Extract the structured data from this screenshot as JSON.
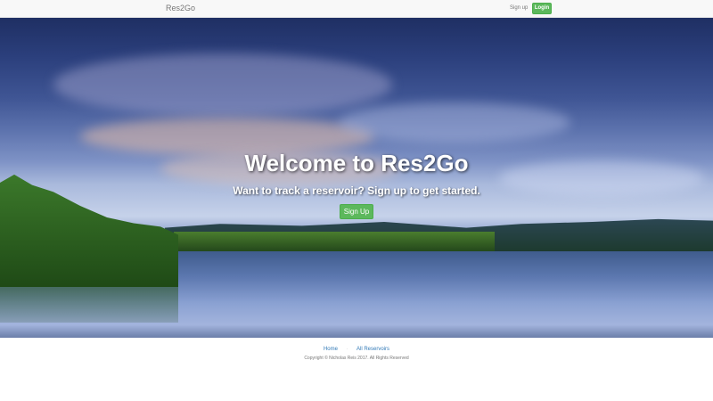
{
  "navbar": {
    "brand": "Res2Go",
    "signup_label": "Sign up",
    "login_label": "Login"
  },
  "hero": {
    "title": "Welcome to Res2Go",
    "subtitle": "Want to track a reservoir? Sign up to get started.",
    "signup_button": "Sign Up"
  },
  "footer": {
    "links": [
      {
        "label": "Home"
      },
      {
        "label": "All Reservoirs"
      }
    ],
    "separator": "·",
    "copyright": "Copyright © Nicholas Reis 2017. All Rights Reserved"
  },
  "colors": {
    "accent": "#5cb85c",
    "link": "#337ab7"
  }
}
